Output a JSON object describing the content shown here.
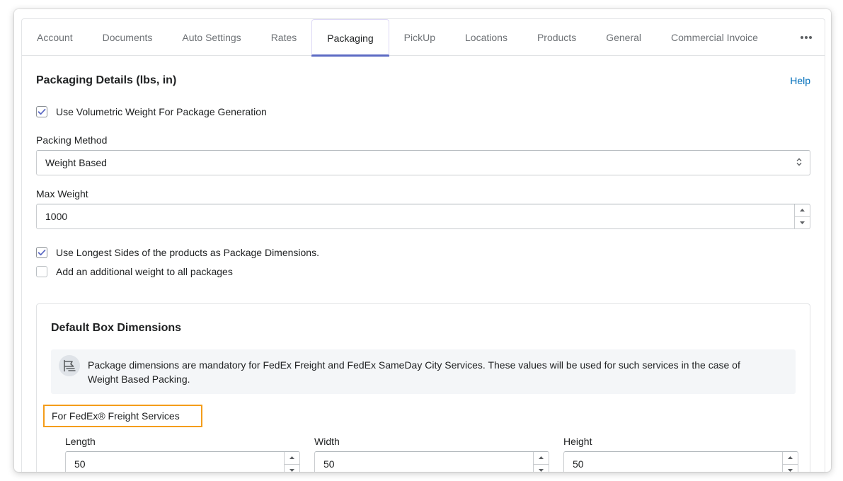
{
  "tabs": [
    {
      "label": "Account"
    },
    {
      "label": "Documents"
    },
    {
      "label": "Auto Settings"
    },
    {
      "label": "Rates"
    },
    {
      "label": "Packaging",
      "active": true
    },
    {
      "label": "PickUp"
    },
    {
      "label": "Locations"
    },
    {
      "label": "Products"
    },
    {
      "label": "General"
    },
    {
      "label": "Commercial Invoice"
    }
  ],
  "more_icon": "more-horizontal-icon",
  "packaging": {
    "title": "Packaging Details (lbs, in)",
    "help": "Help",
    "volumetric": {
      "label": "Use Volumetric Weight For Package Generation",
      "checked": true
    },
    "packing_method": {
      "label": "Packing Method",
      "value": "Weight Based"
    },
    "max_weight": {
      "label": "Max Weight",
      "value": "1000"
    },
    "longest_sides": {
      "label": "Use Longest Sides of the products as Package Dimensions.",
      "checked": true
    },
    "additional_weight": {
      "label": "Add an additional weight to all packages",
      "checked": false
    }
  },
  "box": {
    "title": "Default Box Dimensions",
    "banner_icon": "flag-icon",
    "banner_text": "Package dimensions are mandatory for FedEx Freight and FedEx SameDay City Services. These values will be used for such services in the case of Weight Based Packing.",
    "freight_label": "For FedEx® Freight Services",
    "length": {
      "label": "Length",
      "value": "50"
    },
    "width": {
      "label": "Width",
      "value": "50"
    },
    "height": {
      "label": "Height",
      "value": "50"
    }
  },
  "colors": {
    "accent": "#5c6ac4",
    "link": "#006fbb",
    "highlight_border": "#f49d1a"
  }
}
